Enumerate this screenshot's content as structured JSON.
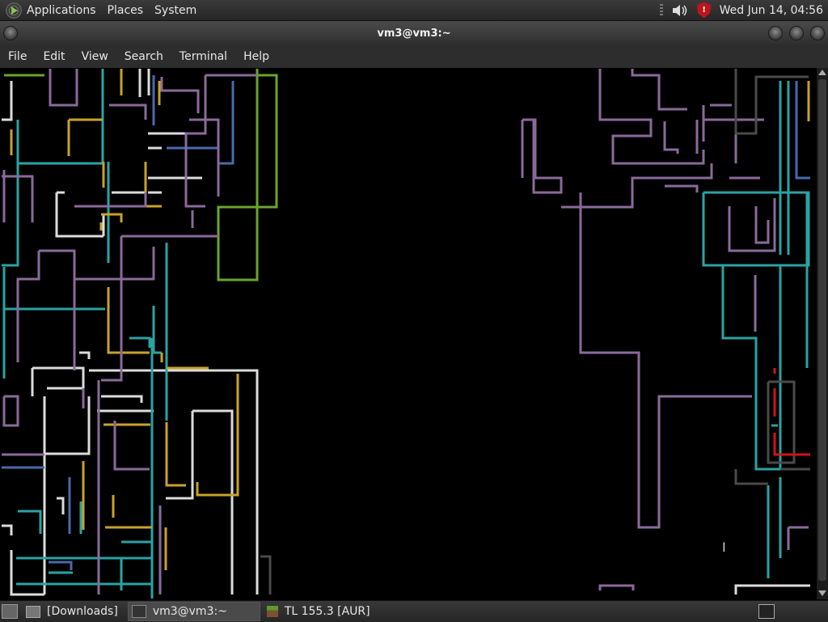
{
  "top_panel": {
    "menus": [
      "Applications",
      "Places",
      "System"
    ],
    "clock": "Wed Jun 14, 04:56"
  },
  "window": {
    "title": "vm3@vm3:~"
  },
  "menubar": [
    "File",
    "Edit",
    "View",
    "Search",
    "Terminal",
    "Help"
  ],
  "taskbar": {
    "items": [
      {
        "label": "[Downloads]",
        "icon": "folder-icon",
        "active": false
      },
      {
        "label": "vm3@vm3:~",
        "icon": "terminal-icon",
        "active": true
      },
      {
        "label": "TL 155.3 [AUR]",
        "icon": "minecraft-icon",
        "active": false
      }
    ]
  },
  "colors": {
    "purple": "#8a6a9a",
    "teal": "#2aa3a3",
    "white": "#dcdcdc",
    "yellow": "#c9a227",
    "green": "#6aa52c",
    "blue": "#4a6aaa",
    "red": "#d01414",
    "gray": "#555555"
  }
}
